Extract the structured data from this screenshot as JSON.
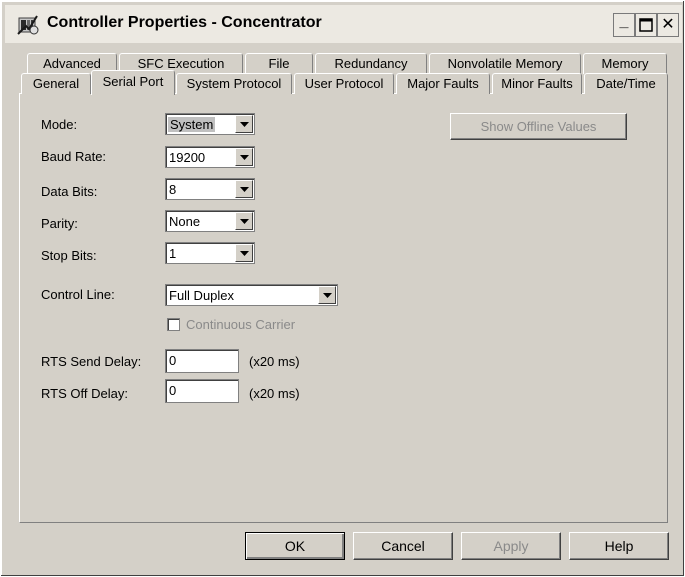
{
  "window": {
    "title": "Controller Properties - Concentrator",
    "minimize_label": "_",
    "close_label": "✕"
  },
  "tabs_row1": [
    {
      "label": "Advanced"
    },
    {
      "label": "SFC Execution"
    },
    {
      "label": "File"
    },
    {
      "label": "Redundancy"
    },
    {
      "label": "Nonvolatile Memory"
    },
    {
      "label": "Memory"
    }
  ],
  "tabs_row2": [
    {
      "label": "General"
    },
    {
      "label": "Serial Port"
    },
    {
      "label": "System Protocol"
    },
    {
      "label": "User Protocol"
    },
    {
      "label": "Major Faults"
    },
    {
      "label": "Minor Faults"
    },
    {
      "label": "Date/Time"
    }
  ],
  "active_tab": "Serial Port",
  "form": {
    "mode": {
      "label": "Mode:",
      "value": "System"
    },
    "baud_rate": {
      "label": "Baud Rate:",
      "value": "19200"
    },
    "data_bits": {
      "label": "Data Bits:",
      "value": "8"
    },
    "parity": {
      "label": "Parity:",
      "value": "None"
    },
    "stop_bits": {
      "label": "Stop Bits:",
      "value": "1"
    },
    "control_line": {
      "label": "Control Line:",
      "value": "Full Duplex"
    },
    "continuous_carrier": {
      "label": "Continuous Carrier",
      "checked": false
    },
    "rts_send_delay": {
      "label": "RTS Send Delay:",
      "value": "0",
      "unit": "(x20 ms)"
    },
    "rts_off_delay": {
      "label": "RTS Off Delay:",
      "value": "0",
      "unit": "(x20 ms)"
    },
    "show_offline_label": "Show Offline Values"
  },
  "buttons": {
    "ok": "OK",
    "cancel": "Cancel",
    "apply": "Apply",
    "help": "Help"
  },
  "icons": {
    "app": "controller-app-icon",
    "dropdown": "chevron-down-icon"
  }
}
